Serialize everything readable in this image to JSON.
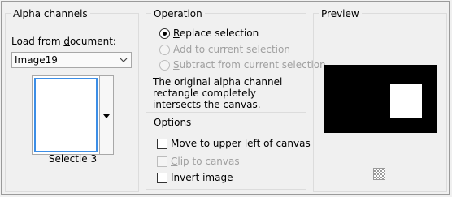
{
  "alpha": {
    "title": "Alpha channels",
    "load_label": "Load from ",
    "load_label_u": "d",
    "load_label_rest": "ocument:",
    "document_value": "Image19",
    "selection_name": "Selectie 3"
  },
  "operation": {
    "title": "Operation",
    "replace_u": "R",
    "replace_rest": "eplace selection",
    "add_u": "A",
    "add_rest": "dd to current selection",
    "subtract_u": "S",
    "subtract_rest": "ubtract from current selection",
    "description": "The original alpha channel rectangle completely intersects the canvas."
  },
  "options": {
    "title": "Options",
    "move_u": "M",
    "move_rest": "ove to upper left of canvas",
    "clip_u": "C",
    "clip_rest": "lip to canvas",
    "invert_u": "I",
    "invert_rest": "nvert image"
  },
  "preview": {
    "title": "Preview"
  }
}
